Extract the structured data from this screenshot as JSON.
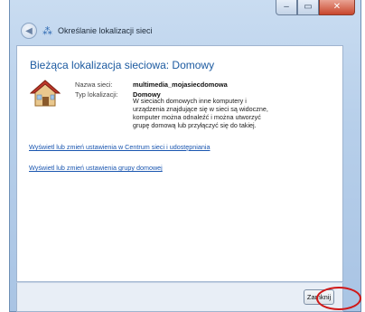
{
  "window": {
    "title": "Określanie lokalizacji sieci",
    "min_label": "–",
    "max_label": "▭",
    "close_label": "✕"
  },
  "main": {
    "heading": "Bieżąca lokalizacja sieciowa: Domowy",
    "network_name_label": "Nazwa sieci:",
    "network_name_value": "multimedia_mojasiecdomowa",
    "location_type_label": "Typ lokalizacji:",
    "location_type_value": "Domowy",
    "description": "W sieciach domowych inne komputery i urządzenia znajdujące się w sieci są widoczne, komputer można odnaleźć i można utworzyć grupę domową lub przyłączyć się do takiej.",
    "link_network_center": "Wyświetl lub zmień ustawienia w Centrum sieci i udostępniania",
    "link_homegroup": "Wyświetl lub zmień ustawienia grupy domowej"
  },
  "footer": {
    "close_label": "Zamknij"
  },
  "icons": {
    "back": "back-arrow-icon",
    "network": "network-icon",
    "house": "house-icon"
  },
  "colors": {
    "heading": "#1c5aa0",
    "link": "#1a56b0",
    "highlight": "#d01818"
  }
}
